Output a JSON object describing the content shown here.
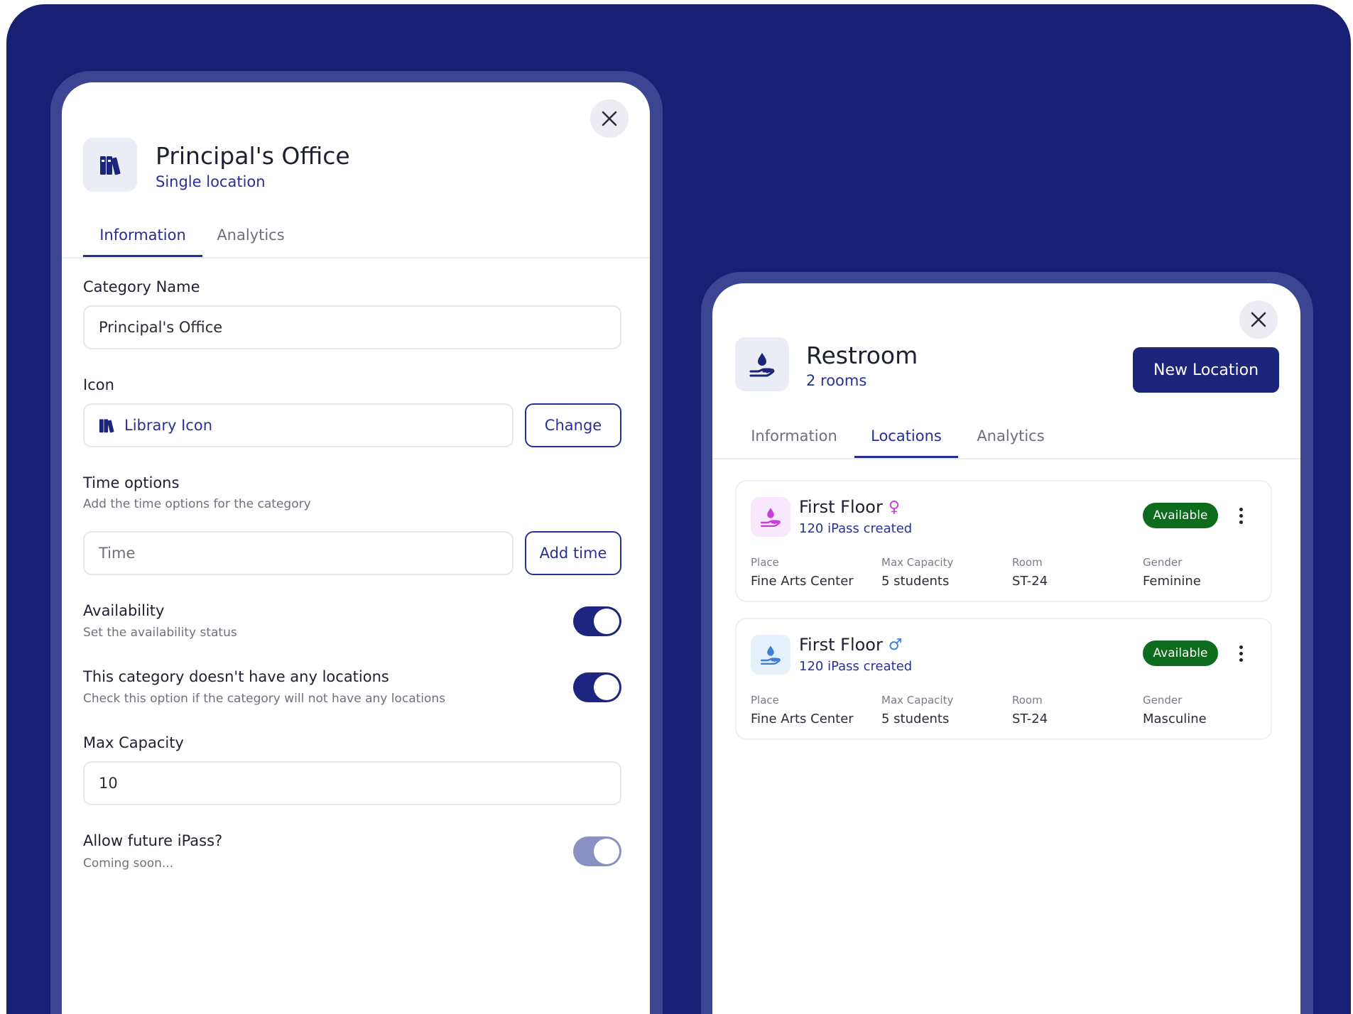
{
  "left_panel": {
    "title": "Principal's Office",
    "subtitle": "Single location",
    "tabs": [
      {
        "label": "Information",
        "active": true
      },
      {
        "label": "Analytics",
        "active": false
      }
    ],
    "category_name": {
      "label": "Category Name",
      "value": "Principal's Office"
    },
    "icon_field": {
      "label": "Icon",
      "value": "Library Icon",
      "icon": "library-icon",
      "change_label": "Change"
    },
    "time_options": {
      "label": "Time options",
      "help": "Add the time options for the category",
      "placeholder": "Time",
      "button_label": "Add time"
    },
    "availability": {
      "label": "Availability",
      "help": "Set the availability status",
      "on": true
    },
    "no_locations": {
      "label": "This category doesn't have any locations",
      "help": "Check this option if the category will not have any locations",
      "on": true
    },
    "max_capacity": {
      "label": "Max Capacity",
      "value": "10"
    },
    "future_ipass": {
      "label": "Allow future iPass?",
      "help": "Coming soon...",
      "on": true,
      "disabled": true
    }
  },
  "right_panel": {
    "title": "Restroom",
    "subtitle": "2 rooms",
    "new_location_label": "New Location",
    "tabs": [
      {
        "label": "Information",
        "active": false
      },
      {
        "label": "Locations",
        "active": true
      },
      {
        "label": "Analytics",
        "active": false
      }
    ],
    "locations": [
      {
        "name": "First Floor",
        "gender_symbol": "♀",
        "ipass": "120 iPass created",
        "status": "Available",
        "fields": [
          {
            "label": "Place",
            "value": "Fine Arts Center"
          },
          {
            "label": "Max Capacity",
            "value": "5 students"
          },
          {
            "label": "Room",
            "value": "ST-24"
          },
          {
            "label": "Gender",
            "value": "Feminine"
          }
        ]
      },
      {
        "name": "First Floor",
        "gender_symbol": "♂",
        "ipass": "120 iPass created",
        "status": "Available",
        "fields": [
          {
            "label": "Place",
            "value": "Fine Arts Center"
          },
          {
            "label": "Max Capacity",
            "value": "5 students"
          },
          {
            "label": "Room",
            "value": "ST-24"
          },
          {
            "label": "Gender",
            "value": "Masculine"
          }
        ]
      }
    ]
  },
  "colors": {
    "background": "#172073",
    "frame": "#3b4591",
    "accent": "#283196",
    "badge_green": "#0c6b1c",
    "feminine": "#c63fd6",
    "masculine": "#3f7fd6"
  }
}
